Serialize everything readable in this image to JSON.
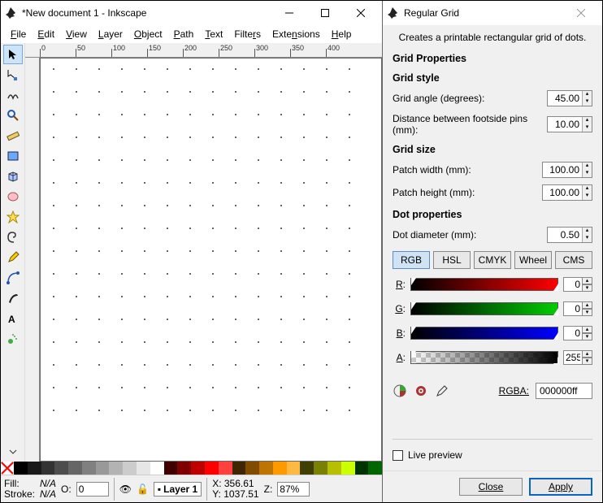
{
  "main": {
    "title": "*New document 1 - Inkscape",
    "menus": [
      {
        "u": "F",
        "rest": "ile"
      },
      {
        "u": "E",
        "rest": "dit"
      },
      {
        "u": "V",
        "rest": "iew"
      },
      {
        "u": "L",
        "rest": "ayer"
      },
      {
        "u": "O",
        "rest": "bject"
      },
      {
        "u": "P",
        "rest": "ath"
      },
      {
        "u": "T",
        "rest": "ext"
      },
      {
        "u": "",
        "rest": "Filte",
        "u2": "r",
        "rest2": "s"
      },
      {
        "u": "",
        "rest": "Exte",
        "u2": "n",
        "rest2": "sions"
      },
      {
        "u": "H",
        "rest": "elp"
      }
    ],
    "ruler_marks": [
      "0",
      "50",
      "100",
      "150",
      "200",
      "250",
      "300",
      "350",
      "400"
    ],
    "status": {
      "fill_label": "Fill:",
      "stroke_label": "Stroke:",
      "fill_value": "N/A",
      "stroke_value": "N/A",
      "opacity_label": "O:",
      "opacity_value": "0",
      "layer_label": "Layer 1",
      "x_label": "X:",
      "y_label": "Y:",
      "x_value": "356.61",
      "y_value": "1037.51",
      "z_label": "Z:",
      "zoom_value": "87%"
    },
    "palette_colors": [
      "#000000",
      "#1a1a1a",
      "#333333",
      "#4d4d4d",
      "#666666",
      "#808080",
      "#999999",
      "#b3b3b3",
      "#cccccc",
      "#e6e6e6",
      "#ffffff",
      "#400000",
      "#800000",
      "#bf0000",
      "#ff0000",
      "#ff4040",
      "#402600",
      "#804c00",
      "#bf7300",
      "#ff9900",
      "#ffb840",
      "#3d4000",
      "#7a8000",
      "#b8bf00",
      "#ccff00",
      "#003300",
      "#006600"
    ]
  },
  "dialog": {
    "title": "Regular Grid",
    "description": "Creates a printable rectangular grid of dots.",
    "section_props": "Grid Properties",
    "section_style": "Grid style",
    "angle_label": "Grid angle (degrees):",
    "angle_value": "45.00",
    "distance_label": "Distance between footside pins (mm):",
    "distance_value": "10.00",
    "section_size": "Grid size",
    "width_label": "Patch width (mm):",
    "width_value": "100.00",
    "height_label": "Patch height (mm):",
    "height_value": "100.00",
    "section_dot": "Dot properties",
    "diameter_label": "Dot diameter (mm):",
    "diameter_value": "0.50",
    "color_tabs": [
      "RGB",
      "HSL",
      "CMYK",
      "Wheel",
      "CMS"
    ],
    "channels": {
      "r_label": "R",
      "r_value": "0",
      "g_label": "G",
      "g_value": "0",
      "b_label": "B",
      "b_value": "0",
      "a_label": "A",
      "a_value": "255"
    },
    "rgba_label": "RGBA:",
    "rgba_value": "000000ff",
    "live_preview": "Live preview",
    "close_btn": "Close",
    "apply_btn": "Apply"
  }
}
